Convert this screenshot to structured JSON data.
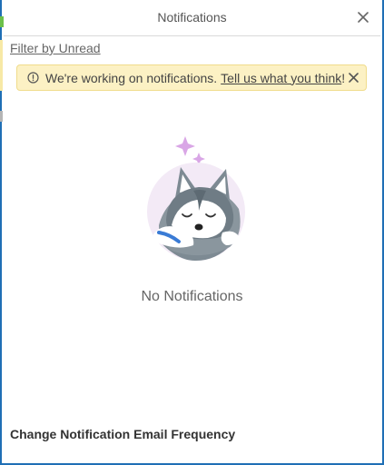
{
  "header": {
    "title": "Notifications",
    "close_icon": "close-icon"
  },
  "filter": {
    "label": "Filter by Unread"
  },
  "banner": {
    "icon": "info-icon",
    "message": "We're working on notifications.",
    "link_text": "Tell us what you think",
    "suffix": "!",
    "close_icon": "close-icon"
  },
  "empty_state": {
    "illustration": "sleeping-husky-illustration",
    "text": "No Notifications"
  },
  "footer": {
    "email_frequency_label": "Change Notification Email Frequency"
  },
  "colors": {
    "frame_accent": "#1f6fb5",
    "banner_bg": "#fcf1c4",
    "banner_border": "#f0dc8c",
    "sparkle": "#d9a6e6"
  }
}
